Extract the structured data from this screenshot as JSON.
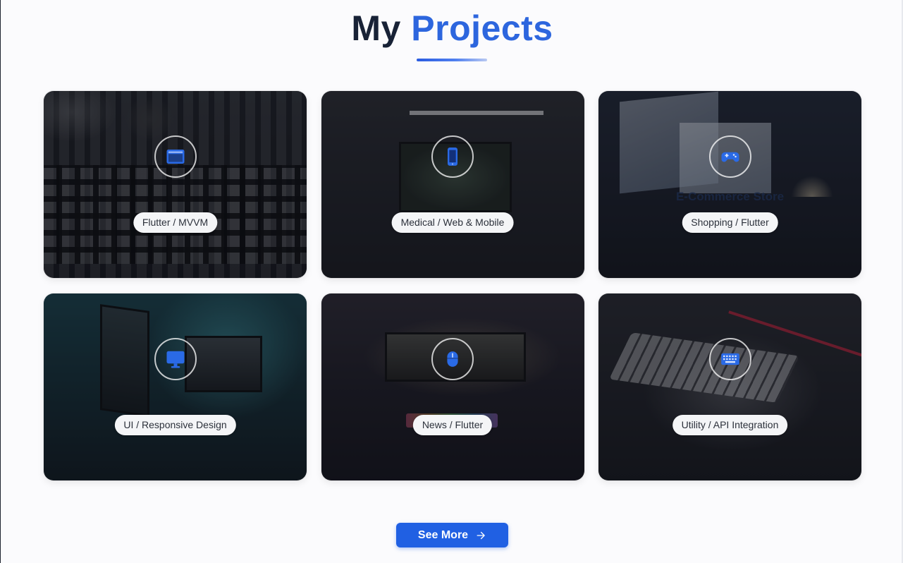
{
  "header": {
    "title_part1": "My",
    "title_part2": "Projects"
  },
  "colors": {
    "accent": "#2d66de",
    "button": "#2060e3",
    "title_dark": "#182236"
  },
  "projects": [
    {
      "icon": "browser-window-icon",
      "title": "",
      "tags": "Flutter / MVVM"
    },
    {
      "icon": "mobile-phone-icon",
      "title": "",
      "tags": "Medical / Web & Mobile"
    },
    {
      "icon": "gamepad-icon",
      "title": "E-Commerce Store",
      "tags": "Shopping / Flutter"
    },
    {
      "icon": "monitor-icon",
      "title": "",
      "tags": "UI / Responsive Design"
    },
    {
      "icon": "mouse-icon",
      "title": "",
      "tags": "News / Flutter"
    },
    {
      "icon": "keyboard-icon",
      "title": "",
      "tags": "Utility / API Integration"
    }
  ],
  "cta": {
    "label": "See More",
    "icon": "arrow-right-icon"
  }
}
